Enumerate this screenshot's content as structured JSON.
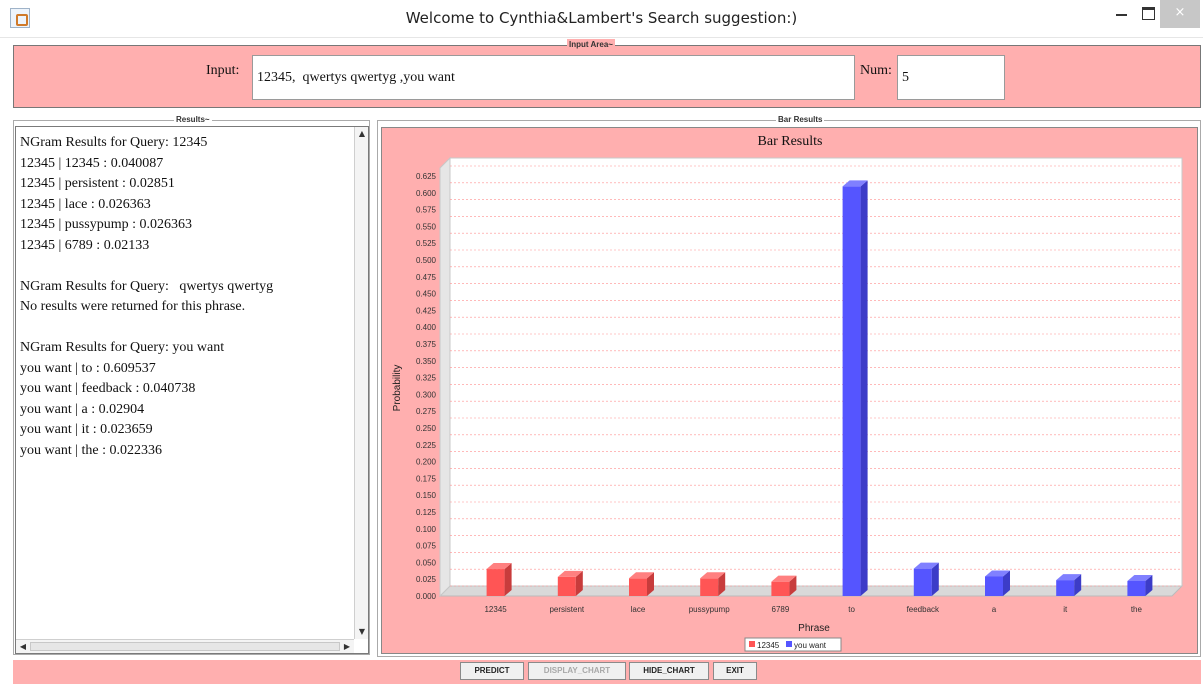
{
  "window": {
    "title": "Welcome to Cynthia&Lambert's Search suggestion:)",
    "close_glyph": "×"
  },
  "input_area": {
    "group_title": "Input Area~",
    "input_label": "Input:",
    "input_value": "12345,  qwertys qwertyg ,you want",
    "num_label": "Num:",
    "num_value": "5"
  },
  "results": {
    "group_title": "Results~",
    "lines": [
      "NGram Results for Query: 12345",
      "12345 | 12345 : 0.040087",
      "12345 | persistent : 0.02851",
      "12345 | lace : 0.026363",
      "12345 | pussypump : 0.026363",
      "12345 | 6789 : 0.02133",
      "",
      "NGram Results for Query:   qwertys qwertyg",
      "No results were returned for this phrase.",
      "",
      "NGram Results for Query: you want",
      "you want | to : 0.609537",
      "you want | feedback : 0.040738",
      "you want | a : 0.02904",
      "you want | it : 0.023659",
      "you want | the : 0.022336"
    ]
  },
  "bar_results": {
    "group_title": "Bar Results"
  },
  "chart_data": {
    "type": "bar",
    "title": "Bar Results",
    "xlabel": "Phrase",
    "ylabel": "Probability",
    "ylim": [
      0,
      0.625
    ],
    "y_tick_step": 0.025,
    "grid": true,
    "legend_position": "bottom",
    "categories": [
      "12345",
      "persistent",
      "lace",
      "pussypump",
      "6789",
      "to",
      "feedback",
      "a",
      "it",
      "the"
    ],
    "series": [
      {
        "name": "12345",
        "color": "#ff5555",
        "values": [
          0.040087,
          0.02851,
          0.026363,
          0.026363,
          0.02133,
          null,
          null,
          null,
          null,
          null
        ]
      },
      {
        "name": "you want",
        "color": "#5555ff",
        "values": [
          null,
          null,
          null,
          null,
          null,
          0.609537,
          0.040738,
          0.02904,
          0.023659,
          0.022336
        ]
      }
    ]
  },
  "buttons": {
    "predict": "PREDICT",
    "display_chart": "DISPLAY_CHART",
    "hide_chart": "HIDE_CHART",
    "exit": "EXIT"
  }
}
